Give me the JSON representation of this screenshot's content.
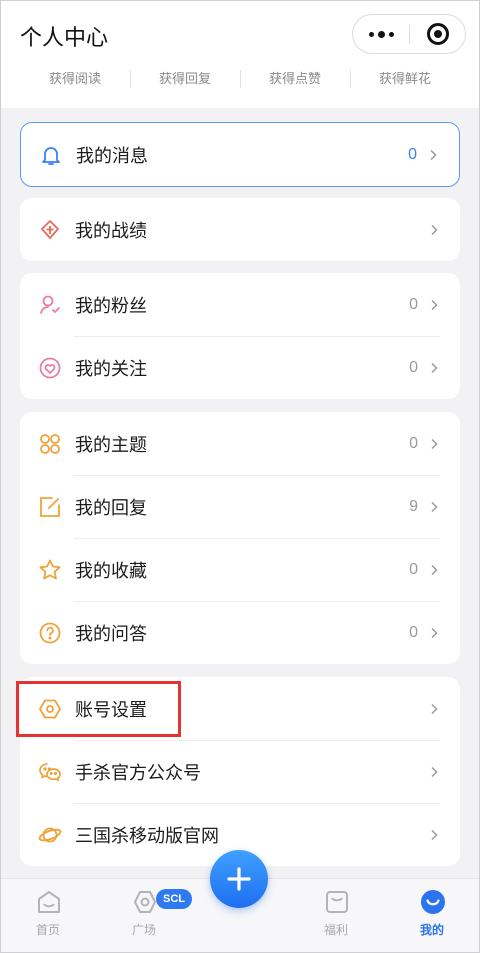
{
  "header": {
    "title": "个人中心",
    "capsule": {
      "more_icon": "more-dots-icon",
      "close_icon": "close-target-icon"
    }
  },
  "stats": [
    "获得阅读",
    "获得回复",
    "获得点赞",
    "获得鲜花"
  ],
  "groups": [
    {
      "items": [
        {
          "icon": "bell-icon",
          "label": "我的消息",
          "count": "0"
        }
      ]
    },
    {
      "items": [
        {
          "icon": "trophy-icon",
          "label": "我的战绩",
          "count": ""
        }
      ]
    },
    {
      "items": [
        {
          "icon": "fans-icon",
          "label": "我的粉丝",
          "count": "0"
        },
        {
          "icon": "heart-icon",
          "label": "我的关注",
          "count": "0"
        }
      ]
    },
    {
      "items": [
        {
          "icon": "grid-icon",
          "label": "我的主题",
          "count": "0"
        },
        {
          "icon": "edit-icon",
          "label": "我的回复",
          "count": "9"
        },
        {
          "icon": "star-icon",
          "label": "我的收藏",
          "count": "0"
        },
        {
          "icon": "question-icon",
          "label": "我的问答",
          "count": "0"
        }
      ]
    },
    {
      "items": [
        {
          "icon": "hexagon-settings-icon",
          "label": "账号设置",
          "count": ""
        },
        {
          "icon": "wechat-icon",
          "label": "手杀官方公众号",
          "count": ""
        },
        {
          "icon": "planet-icon",
          "label": "三国杀移动版官网",
          "count": ""
        }
      ]
    }
  ],
  "tabbar": {
    "tabs": [
      {
        "icon": "home-icon",
        "label": "首页"
      },
      {
        "icon": "plaza-icon",
        "label": "广场",
        "badge": "SCL"
      },
      {
        "icon": "plus-icon",
        "label": ""
      },
      {
        "icon": "gift-bag-icon",
        "label": "福利"
      },
      {
        "icon": "smile-icon",
        "label": "我的"
      }
    ],
    "active_index": 4
  },
  "colors": {
    "accent": "#2b74f0",
    "highlight": "#e53232",
    "icon_orange": "#f0a23a",
    "icon_pink": "#ea7fa0",
    "icon_red": "#e86a5a"
  }
}
